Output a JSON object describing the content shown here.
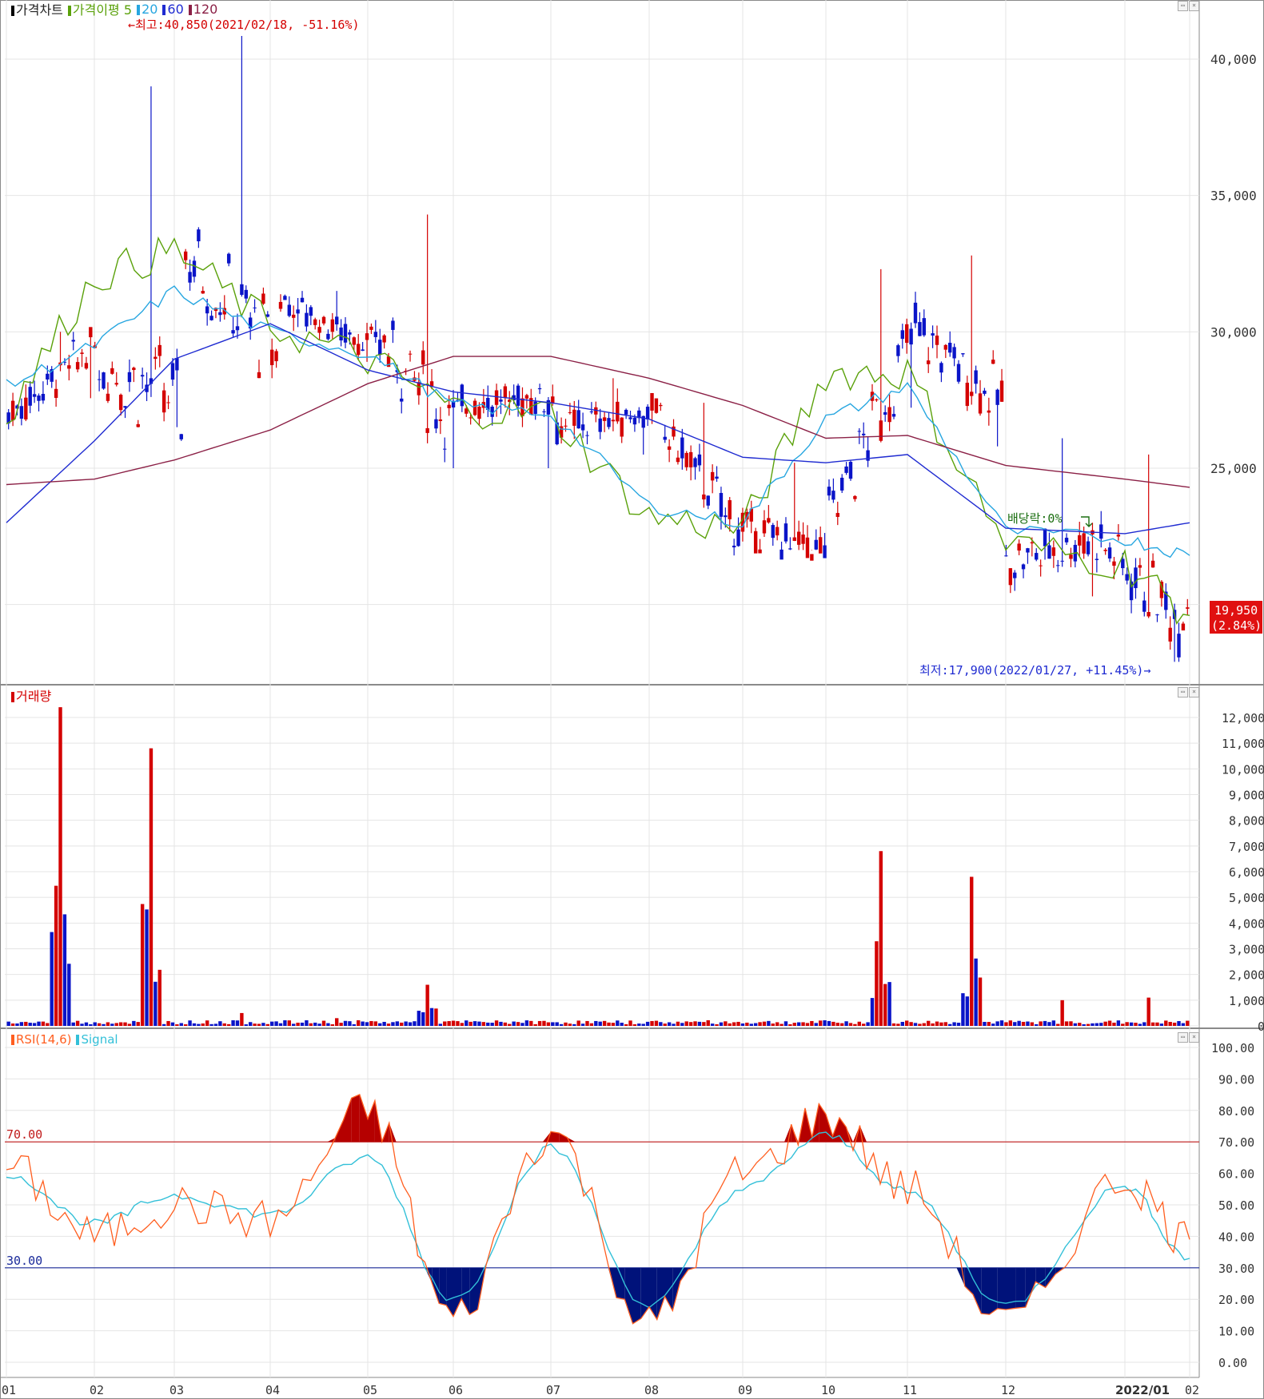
{
  "price_pane": {
    "legend": {
      "chart_name": "가격차트",
      "ma_name": "가격이평",
      "ma5": "5",
      "ma20": "20",
      "ma60": "60",
      "ma120": "120"
    },
    "high_annotation": "←최고:40,850(2021/02/18, -51.16%)",
    "low_annotation": "최저:17,900(2022/01/27, +11.45%)→",
    "dividend_annotation": "배당락:0%",
    "last_price": "19,950",
    "last_change": "(2.84%)"
  },
  "volume_pane": {
    "legend": "거래량"
  },
  "rsi_pane": {
    "legend_rsi": "RSI(14,6)",
    "legend_signal": "Signal",
    "upper_line_label": "70.00",
    "lower_line_label": "30.00"
  },
  "colors": {
    "up": "#d40000",
    "down": "#0a14c8",
    "ma5": "#5aa10a",
    "ma20": "#27a6e0",
    "ma60": "#1f2bd1",
    "ma120": "#8b2046",
    "rsi": "#ff5e1f",
    "signal": "#33c0d8",
    "overbought": "#b50000",
    "oversold": "#00127a",
    "grid": "#e4e4e4",
    "axis": "#8a8a8a"
  },
  "chart_data": [
    {
      "type": "candlestick",
      "title": "가격차트",
      "period": "2021/01 – 2022/02 (daily)",
      "x_ticks": [
        "01",
        "02",
        "03",
        "04",
        "05",
        "06",
        "07",
        "08",
        "09",
        "10",
        "11",
        "12",
        "2022/01",
        "02"
      ],
      "y_ticks": [
        "25,000",
        "30,000",
        "35,000",
        "40,000"
      ],
      "ylim": [
        17500,
        42500
      ],
      "ohlc": [
        [
          "01",
          27000,
          30000,
          26200,
          29500
        ],
        [
          "02",
          29200,
          39000,
          26000,
          27200
        ],
        [
          "03",
          33000,
          40850,
          28300,
          29200
        ],
        [
          "04",
          31200,
          31500,
          28900,
          29500
        ],
        [
          "05",
          29900,
          34300,
          25000,
          26500
        ],
        [
          "06",
          27400,
          28100,
          25000,
          27600
        ],
        [
          "07",
          26500,
          28300,
          25500,
          27000
        ],
        [
          "08",
          27000,
          27400,
          21800,
          22800
        ],
        [
          "09",
          22800,
          25200,
          22000,
          22000
        ],
        [
          "10",
          23000,
          32300,
          22300,
          30000
        ],
        [
          "11",
          29900,
          32800,
          25800,
          27500
        ],
        [
          "12",
          21600,
          26100,
          20300,
          22500
        ],
        [
          "2022/01",
          22300,
          25500,
          17900,
          19400
        ],
        [
          "02",
          19400,
          20200,
          19200,
          19950
        ]
      ],
      "moving_averages": [
        {
          "name": "5",
          "values": [
            27000,
            32000,
            33000,
            30200,
            29000,
            27200,
            27000,
            23200,
            22800,
            28500,
            28500,
            22200,
            21500,
            19600
          ]
        },
        {
          "name": "20",
          "values": [
            28000,
            29500,
            31500,
            30000,
            29200,
            27300,
            27000,
            23600,
            23000,
            26800,
            28000,
            22700,
            22400,
            21800
          ]
        },
        {
          "name": "60",
          "values": [
            23000,
            26000,
            29000,
            30300,
            28600,
            27800,
            27400,
            26800,
            25400,
            25200,
            25500,
            22800,
            22600,
            23000
          ]
        },
        {
          "name": "120",
          "values": [
            24400,
            24600,
            25300,
            26400,
            28100,
            29100,
            29100,
            28300,
            27300,
            26100,
            26200,
            25100,
            24600,
            24300
          ]
        }
      ]
    },
    {
      "type": "bar",
      "title": "거래량",
      "categories": [
        "01",
        "02",
        "03",
        "04",
        "05",
        "06",
        "07",
        "08",
        "09",
        "10",
        "11",
        "12",
        "2022/01",
        "02"
      ],
      "series": [
        {
          "name": "거래량",
          "values": [
            12400,
            10800,
            500,
            300,
            1600,
            150,
            120,
            150,
            120,
            6800,
            5800,
            1000,
            1100,
            200
          ]
        }
      ],
      "y_ticks": [
        "0K",
        "1,000K",
        "2,000K",
        "3,000K",
        "4,000K",
        "5,000K",
        "6,000K",
        "7,000K",
        "8,000K",
        "9,000K",
        "10,000K",
        "11,000K",
        "12,000K"
      ],
      "ylim": [
        0,
        12500
      ]
    },
    {
      "type": "line",
      "title": "RSI(14,6)",
      "categories": [
        "01",
        "02",
        "03",
        "04",
        "05",
        "06",
        "07",
        "08",
        "09",
        "10",
        "11",
        "12",
        "2022/01",
        "02"
      ],
      "series": [
        {
          "name": "RSI(14,6)",
          "values": [
            62,
            40,
            50,
            45,
            80,
            14,
            73,
            12,
            60,
            78,
            55,
            12,
            58,
            39
          ]
        },
        {
          "name": "Signal",
          "values": [
            60,
            44,
            53,
            47,
            65,
            20,
            68,
            18,
            55,
            72,
            54,
            18,
            56,
            33
          ]
        }
      ],
      "reference_lines": [
        70,
        30
      ],
      "y_ticks": [
        "0.00",
        "10.00",
        "20.00",
        "30.00",
        "40.00",
        "50.00",
        "60.00",
        "70.00",
        "80.00",
        "90.00",
        "100.00"
      ],
      "ylim": [
        0,
        100
      ]
    }
  ]
}
